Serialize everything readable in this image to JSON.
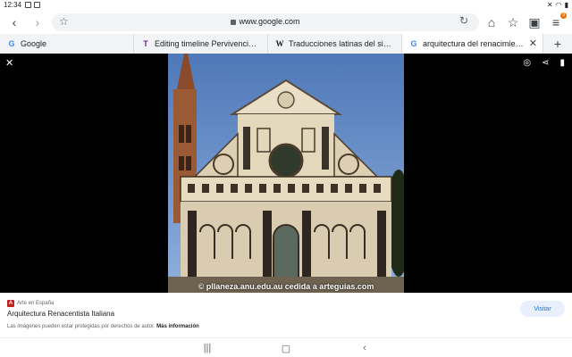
{
  "status": {
    "time": "12:34"
  },
  "toolbar": {
    "url": "www.google.com",
    "tab_count_badge": "9"
  },
  "tabs": [
    {
      "favicon": "G",
      "label": "Google"
    },
    {
      "favicon": "T",
      "label": "Editing timeline Pervivencia de l..."
    },
    {
      "favicon": "W",
      "label": "Traducciones latinas del siglo XI..."
    },
    {
      "favicon": "G",
      "label": "arquitectura del renacimient..."
    }
  ],
  "viewer": {
    "watermark": "© pllaneza.anu.edu.au cedida a arteguias.com",
    "close_icon": "close-icon",
    "actions": [
      "lens-icon",
      "share-icon",
      "bookmark-icon"
    ]
  },
  "result": {
    "source": "Arte en España",
    "source_logo": "A",
    "title": "Arquitectura Renacentista Italiana",
    "notice_text": "Las imágenes pueden estar protegidas por derechos de autor.",
    "notice_link": "Más información",
    "visit_label": "Visitar"
  },
  "colors": {
    "accent": "#1a73e8",
    "visit_bg": "#e8f0fe",
    "viewer_bg": "#000000"
  }
}
